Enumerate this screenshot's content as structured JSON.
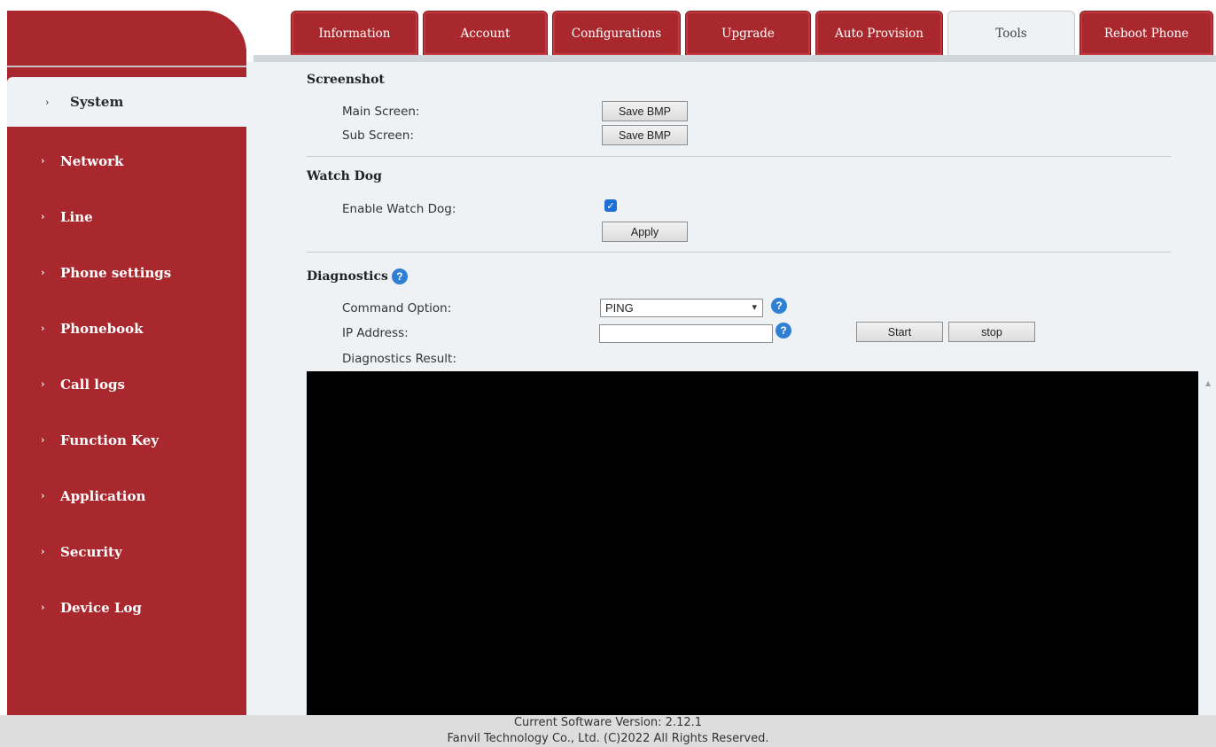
{
  "tabs": [
    {
      "label": "Information"
    },
    {
      "label": "Account"
    },
    {
      "label": "Configurations"
    },
    {
      "label": "Upgrade"
    },
    {
      "label": "Auto Provision"
    },
    {
      "label": "Tools"
    },
    {
      "label": "Reboot Phone"
    }
  ],
  "active_tab": "Tools",
  "sidebar": {
    "items": [
      {
        "label": "System"
      },
      {
        "label": "Network"
      },
      {
        "label": "Line"
      },
      {
        "label": "Phone settings"
      },
      {
        "label": "Phonebook"
      },
      {
        "label": "Call logs"
      },
      {
        "label": "Function Key"
      },
      {
        "label": "Application"
      },
      {
        "label": "Security"
      },
      {
        "label": "Device Log"
      }
    ],
    "active_item": "System"
  },
  "screenshot": {
    "title": "Screenshot",
    "main_screen_label": "Main Screen:",
    "sub_screen_label": "Sub Screen:",
    "save_bmp_label": "Save BMP"
  },
  "watchdog": {
    "title": "Watch Dog",
    "enable_label": "Enable Watch Dog:",
    "enabled": true,
    "apply_label": "Apply"
  },
  "diagnostics": {
    "title": "Diagnostics",
    "command_option_label": "Command Option:",
    "command_option_value": "PING",
    "ip_address_label": "IP Address:",
    "ip_address_value": "",
    "start_label": "Start",
    "stop_label": "stop",
    "result_label": "Diagnostics Result:"
  },
  "footer": {
    "version": "Current Software Version: 2.12.1",
    "copyright": "Fanvil Technology Co., Ltd. (C)2022 All Rights Reserved."
  },
  "colors": {
    "brand_red": "#a9282d",
    "panel_bg": "#eef2f5",
    "help_blue": "#2f7fd3",
    "checkbox_blue": "#1f6fd6"
  }
}
